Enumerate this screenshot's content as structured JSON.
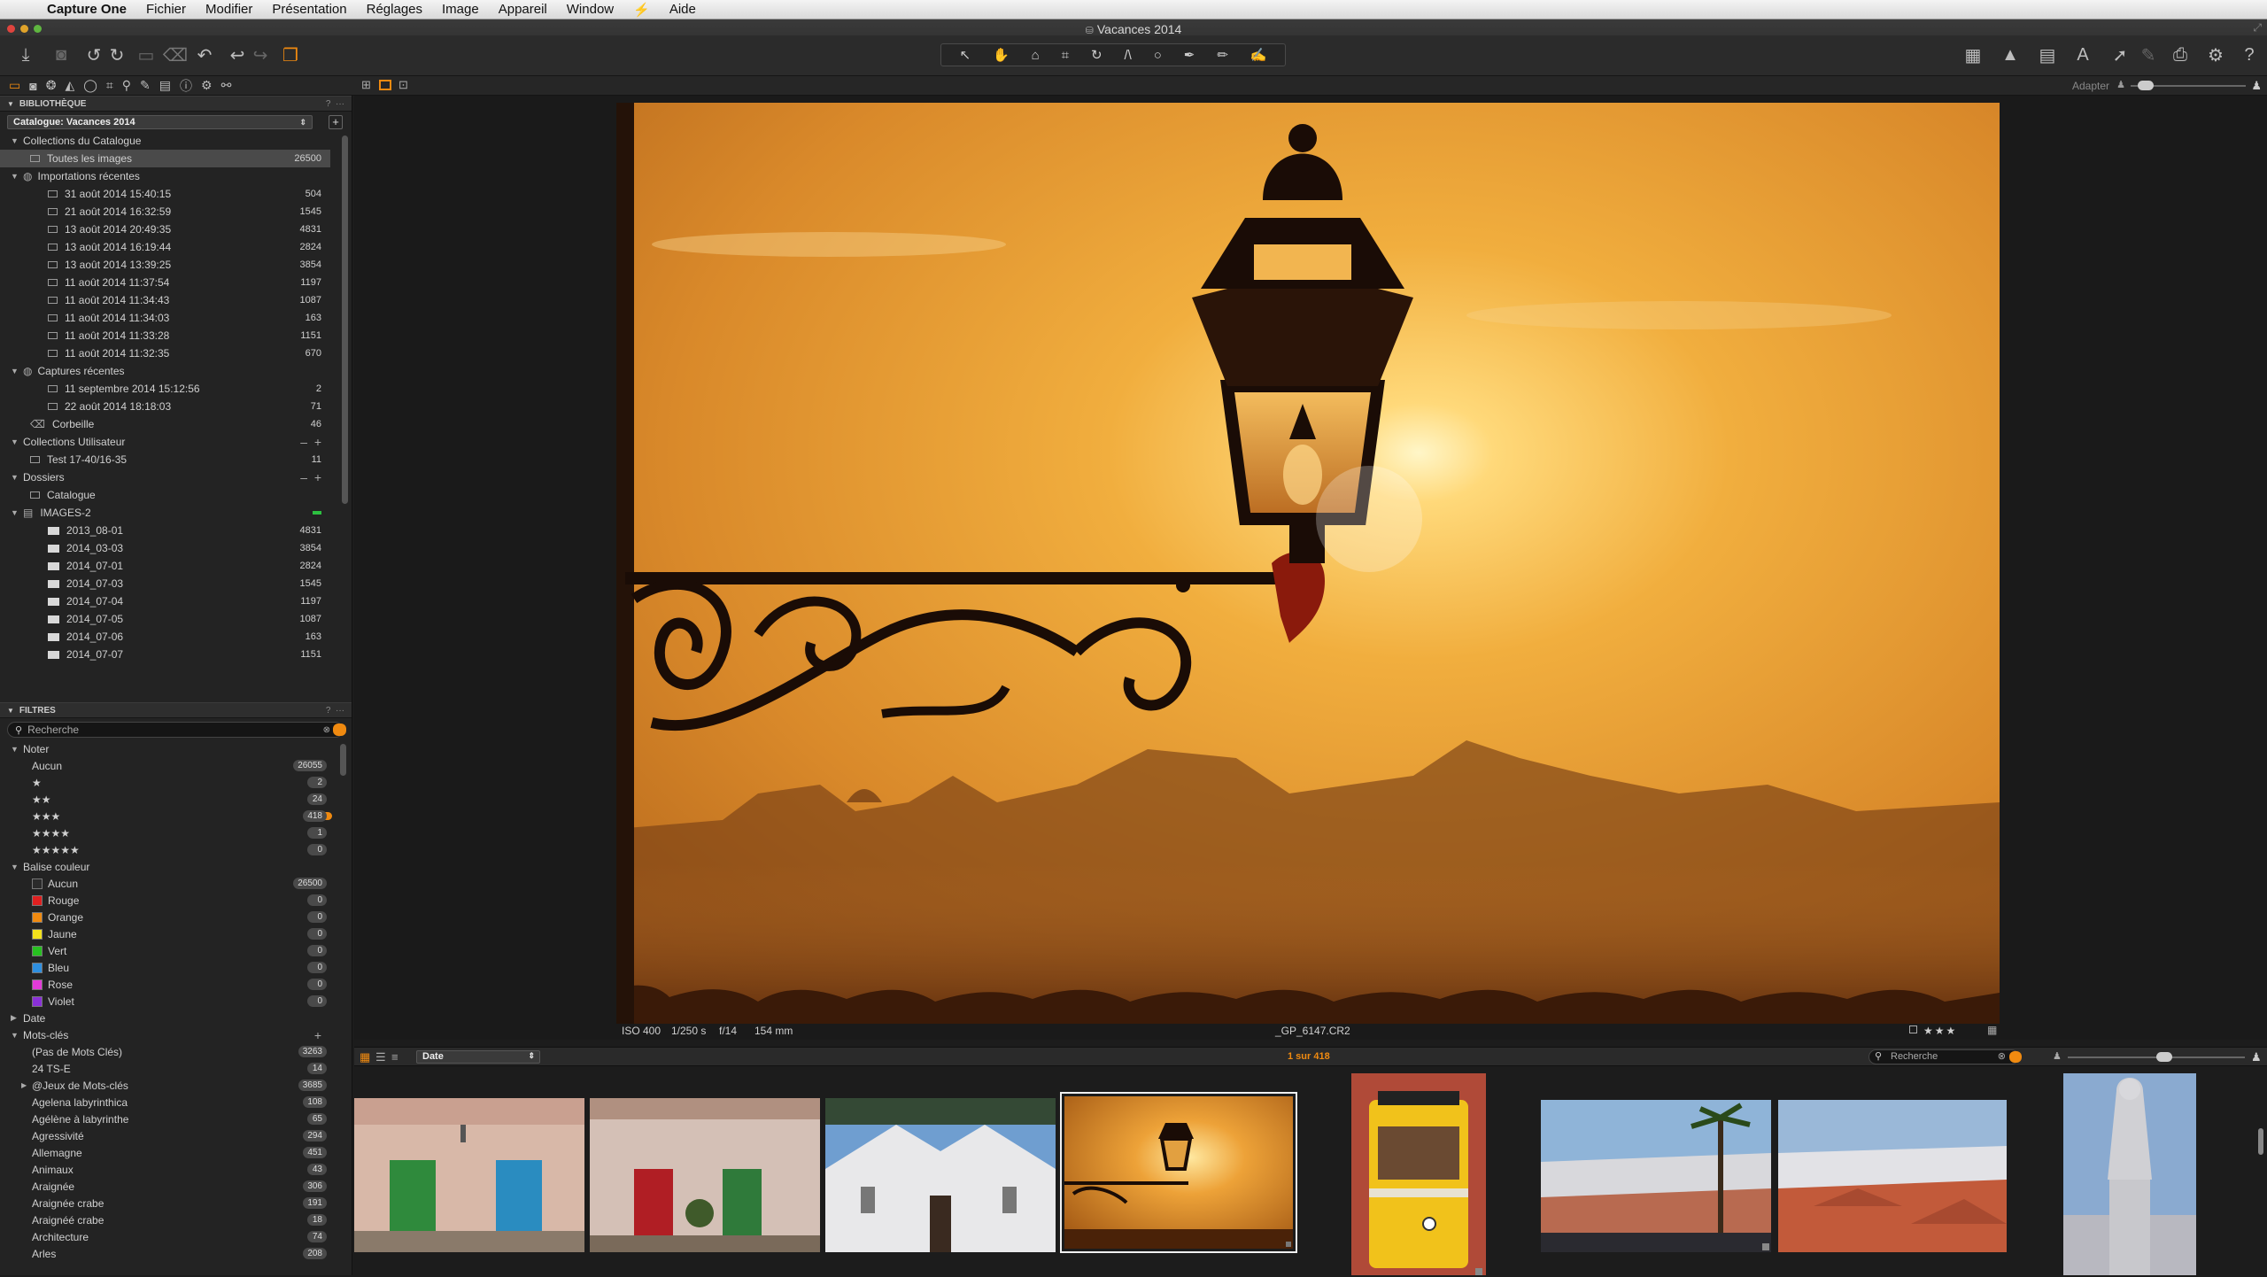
{
  "menubar": {
    "app_name": "Capture One",
    "items": [
      "Fichier",
      "Modifier",
      "Présentation",
      "Réglages",
      "Image",
      "Appareil",
      "Window",
      "Aide"
    ],
    "apple_glyph": "",
    "script_glyph": "⚡"
  },
  "window": {
    "title": "Vacances 2014",
    "title_icon": "catalog-icon"
  },
  "viewer_controls": {
    "fit_label": "Adapter"
  },
  "library": {
    "header": "BIBLIOTHÈQUE",
    "catalog_selector": "Catalogue: Vacances 2014",
    "catalog_collections": {
      "label": "Collections du Catalogue",
      "all_images": {
        "label": "Toutes les images",
        "count": "26500"
      },
      "recent_imports": {
        "label": "Importations récentes",
        "items": [
          {
            "label": "31 août 2014 15:40:15",
            "count": "504"
          },
          {
            "label": "21 août 2014 16:32:59",
            "count": "1545"
          },
          {
            "label": "13 août 2014 20:49:35",
            "count": "4831"
          },
          {
            "label": "13 août 2014 16:19:44",
            "count": "2824"
          },
          {
            "label": "13 août 2014 13:39:25",
            "count": "3854"
          },
          {
            "label": "11 août 2014 11:37:54",
            "count": "1197"
          },
          {
            "label": "11 août 2014 11:34:43",
            "count": "1087"
          },
          {
            "label": "11 août 2014 11:34:03",
            "count": "163"
          },
          {
            "label": "11 août 2014 11:33:28",
            "count": "1151"
          },
          {
            "label": "11 août 2014 11:32:35",
            "count": "670"
          }
        ]
      },
      "recent_captures": {
        "label": "Captures récentes",
        "items": [
          {
            "label": "11 septembre 2014 15:12:56",
            "count": "2"
          },
          {
            "label": "22 août 2014 18:18:03",
            "count": "71"
          }
        ]
      },
      "trash": {
        "label": "Corbeille",
        "count": "46"
      }
    },
    "user_collections": {
      "label": "Collections Utilisateur",
      "items": [
        {
          "label": "Test 17-40/16-35",
          "count": "11"
        }
      ]
    },
    "folders": {
      "label": "Dossiers",
      "catalog": "Catalogue",
      "volume": "IMAGES-2",
      "items": [
        {
          "label": "2013_08-01",
          "count": "4831"
        },
        {
          "label": "2014_03-03",
          "count": "3854"
        },
        {
          "label": "2014_07-01",
          "count": "2824"
        },
        {
          "label": "2014_07-03",
          "count": "1545"
        },
        {
          "label": "2014_07-04",
          "count": "1197"
        },
        {
          "label": "2014_07-05",
          "count": "1087"
        },
        {
          "label": "2014_07-06",
          "count": "163"
        },
        {
          "label": "2014_07-07",
          "count": "1151"
        }
      ]
    }
  },
  "filters": {
    "header": "FILTRES",
    "search_placeholder": "Recherche",
    "rating": {
      "label": "Noter",
      "items": [
        {
          "label": "Aucun",
          "count": "26055"
        },
        {
          "label": "★",
          "count": "2"
        },
        {
          "label": "★★",
          "count": "24"
        },
        {
          "label": "★★★",
          "count": "418"
        },
        {
          "label": "★★★★",
          "count": "1"
        },
        {
          "label": "★★★★★",
          "count": "0"
        }
      ]
    },
    "color_tag": {
      "label": "Balise couleur",
      "items": [
        {
          "label": "Aucun",
          "count": "26500",
          "color": "#2b2b2b"
        },
        {
          "label": "Rouge",
          "count": "0",
          "color": "#e02020"
        },
        {
          "label": "Orange",
          "count": "0",
          "color": "#f08a10"
        },
        {
          "label": "Jaune",
          "count": "0",
          "color": "#f2e21c"
        },
        {
          "label": "Vert",
          "count": "0",
          "color": "#27c020"
        },
        {
          "label": "Bleu",
          "count": "0",
          "color": "#2e8fe0"
        },
        {
          "label": "Rose",
          "count": "0",
          "color": "#e23ad8"
        },
        {
          "label": "Violet",
          "count": "0",
          "color": "#8a30d8"
        }
      ]
    },
    "date_label": "Date",
    "keywords": {
      "label": "Mots-clés",
      "items": [
        {
          "label": "(Pas de Mots Clés)",
          "count": "3263"
        },
        {
          "label": "24 TS-E",
          "count": "14"
        },
        {
          "label": "@Jeux de Mots-clés",
          "count": "3685"
        },
        {
          "label": "Agelena labyrinthica",
          "count": "108"
        },
        {
          "label": "Agélène à labyrinthe",
          "count": "65"
        },
        {
          "label": "Agressivité",
          "count": "294"
        },
        {
          "label": "Allemagne",
          "count": "451"
        },
        {
          "label": "Animaux",
          "count": "43"
        },
        {
          "label": "Araignée",
          "count": "306"
        },
        {
          "label": "Araignée crabe",
          "count": "191"
        },
        {
          "label": "Araignéé crabe",
          "count": "18"
        },
        {
          "label": "Architecture",
          "count": "74"
        },
        {
          "label": "Arles",
          "count": "208"
        }
      ]
    }
  },
  "image_info": {
    "iso": "ISO 400",
    "shutter": "1/250 s",
    "aperture": "f/14",
    "focal": "154 mm",
    "filename": "_GP_6147.CR2",
    "rating": "★★★"
  },
  "browser": {
    "sort": "Date",
    "position": "1 sur 418",
    "search_placeholder": "Recherche",
    "thumbnails": [
      "houses-doors",
      "houses-doors-2",
      "church",
      "street-lamp",
      "yellow-tram",
      "lisbon-view-palm",
      "lisbon-rooftops",
      "statue"
    ],
    "selected_index": 3
  },
  "colors": {
    "accent": "#f08a10",
    "panel": "#232323",
    "selection": "#4a4a4a"
  }
}
